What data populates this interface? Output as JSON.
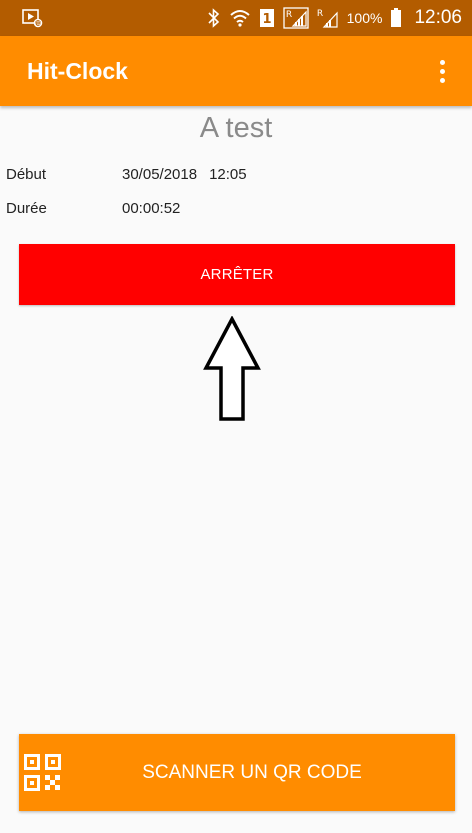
{
  "status_bar": {
    "battery_percent": "100%",
    "time": "12:06",
    "sim_label": "1",
    "roaming_label": "R",
    "icons": [
      "media-notification-icon",
      "bluetooth-icon",
      "wifi-icon",
      "sim-icon",
      "signal-roaming-icon",
      "signal-icon",
      "battery-icon"
    ]
  },
  "app_bar": {
    "title": "Hit-Clock",
    "menu_icon": "overflow-menu-icon"
  },
  "task": {
    "name": "A test",
    "start_label": "Début",
    "start_date": "30/05/2018",
    "start_time": "12:05",
    "duration_label": "Durée",
    "duration_value": "00:00:52"
  },
  "actions": {
    "stop_label": "ARRÊTER",
    "scan_label": "SCANNER UN QR CODE",
    "scan_icon": "qr-code-icon"
  },
  "colors": {
    "status_bar": "#b35c00",
    "app_bar": "#ff8c00",
    "stop_button": "#ff0000",
    "scan_button": "#ff8c00",
    "task_name": "#8a8a8a"
  }
}
